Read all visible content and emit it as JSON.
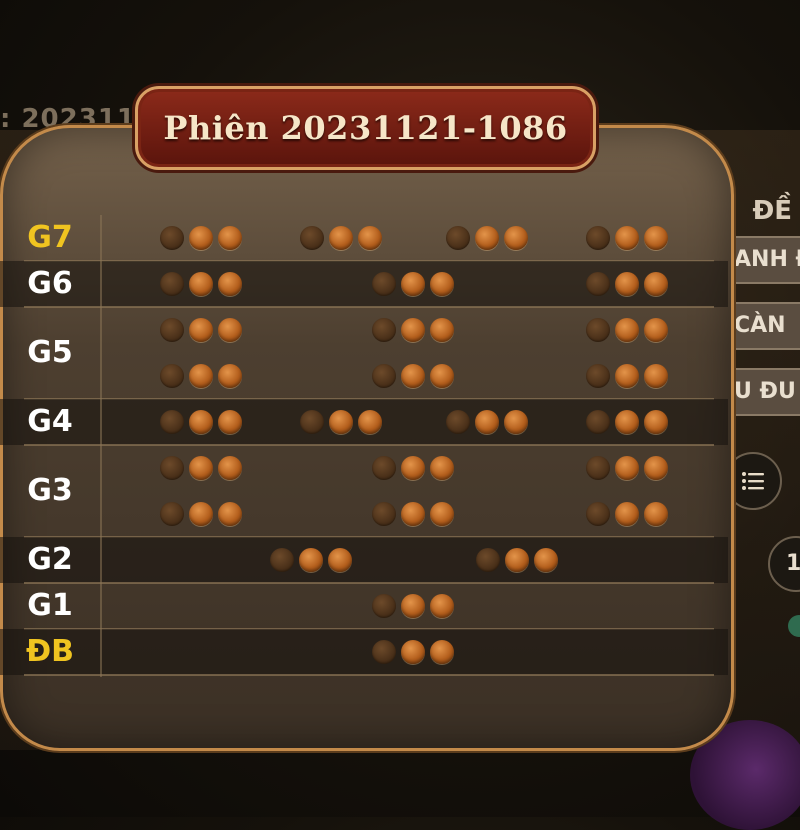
{
  "session_title": "Phiên 20231121-1086",
  "background": {
    "session_partial": ": 202311",
    "side_heading": "ĐỀ",
    "side_tabs": [
      "ANH Đ",
      "CÀN",
      "U ĐU"
    ],
    "side_counter": "1"
  },
  "rows": [
    {
      "label": "G7",
      "highlight": true,
      "groups": [
        4
      ]
    },
    {
      "label": "G6",
      "highlight": false,
      "groups": [
        3
      ]
    },
    {
      "label": "G5",
      "highlight": false,
      "groups": [
        3,
        3
      ]
    },
    {
      "label": "G4",
      "highlight": false,
      "groups": [
        4
      ]
    },
    {
      "label": "G3",
      "highlight": false,
      "groups": [
        3,
        3
      ]
    },
    {
      "label": "G2",
      "highlight": false,
      "groups": [
        2
      ]
    },
    {
      "label": "G1",
      "highlight": false,
      "groups": [
        1
      ]
    },
    {
      "label": "ĐB",
      "highlight": true,
      "groups": [
        1
      ]
    }
  ],
  "colors": {
    "label_highlight": "#f0c420",
    "label_normal": "#ffffff",
    "ball_active": "#c06a24",
    "ball_dim": "#4a3019",
    "frame_border": "#c38a4a",
    "title_plate": "#7a2414"
  }
}
